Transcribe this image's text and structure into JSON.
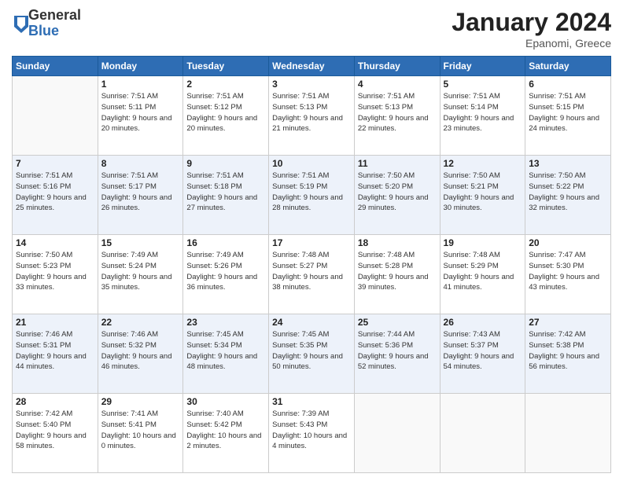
{
  "header": {
    "logo_general": "General",
    "logo_blue": "Blue",
    "title": "January 2024",
    "location": "Epanomi, Greece"
  },
  "weekdays": [
    "Sunday",
    "Monday",
    "Tuesday",
    "Wednesday",
    "Thursday",
    "Friday",
    "Saturday"
  ],
  "weeks": [
    [
      {
        "day": "",
        "sunrise": "",
        "sunset": "",
        "daylight": ""
      },
      {
        "day": "1",
        "sunrise": "Sunrise: 7:51 AM",
        "sunset": "Sunset: 5:11 PM",
        "daylight": "Daylight: 9 hours and 20 minutes."
      },
      {
        "day": "2",
        "sunrise": "Sunrise: 7:51 AM",
        "sunset": "Sunset: 5:12 PM",
        "daylight": "Daylight: 9 hours and 20 minutes."
      },
      {
        "day": "3",
        "sunrise": "Sunrise: 7:51 AM",
        "sunset": "Sunset: 5:13 PM",
        "daylight": "Daylight: 9 hours and 21 minutes."
      },
      {
        "day": "4",
        "sunrise": "Sunrise: 7:51 AM",
        "sunset": "Sunset: 5:13 PM",
        "daylight": "Daylight: 9 hours and 22 minutes."
      },
      {
        "day": "5",
        "sunrise": "Sunrise: 7:51 AM",
        "sunset": "Sunset: 5:14 PM",
        "daylight": "Daylight: 9 hours and 23 minutes."
      },
      {
        "day": "6",
        "sunrise": "Sunrise: 7:51 AM",
        "sunset": "Sunset: 5:15 PM",
        "daylight": "Daylight: 9 hours and 24 minutes."
      }
    ],
    [
      {
        "day": "7",
        "sunrise": "Sunrise: 7:51 AM",
        "sunset": "Sunset: 5:16 PM",
        "daylight": "Daylight: 9 hours and 25 minutes."
      },
      {
        "day": "8",
        "sunrise": "Sunrise: 7:51 AM",
        "sunset": "Sunset: 5:17 PM",
        "daylight": "Daylight: 9 hours and 26 minutes."
      },
      {
        "day": "9",
        "sunrise": "Sunrise: 7:51 AM",
        "sunset": "Sunset: 5:18 PM",
        "daylight": "Daylight: 9 hours and 27 minutes."
      },
      {
        "day": "10",
        "sunrise": "Sunrise: 7:51 AM",
        "sunset": "Sunset: 5:19 PM",
        "daylight": "Daylight: 9 hours and 28 minutes."
      },
      {
        "day": "11",
        "sunrise": "Sunrise: 7:50 AM",
        "sunset": "Sunset: 5:20 PM",
        "daylight": "Daylight: 9 hours and 29 minutes."
      },
      {
        "day": "12",
        "sunrise": "Sunrise: 7:50 AM",
        "sunset": "Sunset: 5:21 PM",
        "daylight": "Daylight: 9 hours and 30 minutes."
      },
      {
        "day": "13",
        "sunrise": "Sunrise: 7:50 AM",
        "sunset": "Sunset: 5:22 PM",
        "daylight": "Daylight: 9 hours and 32 minutes."
      }
    ],
    [
      {
        "day": "14",
        "sunrise": "Sunrise: 7:50 AM",
        "sunset": "Sunset: 5:23 PM",
        "daylight": "Daylight: 9 hours and 33 minutes."
      },
      {
        "day": "15",
        "sunrise": "Sunrise: 7:49 AM",
        "sunset": "Sunset: 5:24 PM",
        "daylight": "Daylight: 9 hours and 35 minutes."
      },
      {
        "day": "16",
        "sunrise": "Sunrise: 7:49 AM",
        "sunset": "Sunset: 5:26 PM",
        "daylight": "Daylight: 9 hours and 36 minutes."
      },
      {
        "day": "17",
        "sunrise": "Sunrise: 7:48 AM",
        "sunset": "Sunset: 5:27 PM",
        "daylight": "Daylight: 9 hours and 38 minutes."
      },
      {
        "day": "18",
        "sunrise": "Sunrise: 7:48 AM",
        "sunset": "Sunset: 5:28 PM",
        "daylight": "Daylight: 9 hours and 39 minutes."
      },
      {
        "day": "19",
        "sunrise": "Sunrise: 7:48 AM",
        "sunset": "Sunset: 5:29 PM",
        "daylight": "Daylight: 9 hours and 41 minutes."
      },
      {
        "day": "20",
        "sunrise": "Sunrise: 7:47 AM",
        "sunset": "Sunset: 5:30 PM",
        "daylight": "Daylight: 9 hours and 43 minutes."
      }
    ],
    [
      {
        "day": "21",
        "sunrise": "Sunrise: 7:46 AM",
        "sunset": "Sunset: 5:31 PM",
        "daylight": "Daylight: 9 hours and 44 minutes."
      },
      {
        "day": "22",
        "sunrise": "Sunrise: 7:46 AM",
        "sunset": "Sunset: 5:32 PM",
        "daylight": "Daylight: 9 hours and 46 minutes."
      },
      {
        "day": "23",
        "sunrise": "Sunrise: 7:45 AM",
        "sunset": "Sunset: 5:34 PM",
        "daylight": "Daylight: 9 hours and 48 minutes."
      },
      {
        "day": "24",
        "sunrise": "Sunrise: 7:45 AM",
        "sunset": "Sunset: 5:35 PM",
        "daylight": "Daylight: 9 hours and 50 minutes."
      },
      {
        "day": "25",
        "sunrise": "Sunrise: 7:44 AM",
        "sunset": "Sunset: 5:36 PM",
        "daylight": "Daylight: 9 hours and 52 minutes."
      },
      {
        "day": "26",
        "sunrise": "Sunrise: 7:43 AM",
        "sunset": "Sunset: 5:37 PM",
        "daylight": "Daylight: 9 hours and 54 minutes."
      },
      {
        "day": "27",
        "sunrise": "Sunrise: 7:42 AM",
        "sunset": "Sunset: 5:38 PM",
        "daylight": "Daylight: 9 hours and 56 minutes."
      }
    ],
    [
      {
        "day": "28",
        "sunrise": "Sunrise: 7:42 AM",
        "sunset": "Sunset: 5:40 PM",
        "daylight": "Daylight: 9 hours and 58 minutes."
      },
      {
        "day": "29",
        "sunrise": "Sunrise: 7:41 AM",
        "sunset": "Sunset: 5:41 PM",
        "daylight": "Daylight: 10 hours and 0 minutes."
      },
      {
        "day": "30",
        "sunrise": "Sunrise: 7:40 AM",
        "sunset": "Sunset: 5:42 PM",
        "daylight": "Daylight: 10 hours and 2 minutes."
      },
      {
        "day": "31",
        "sunrise": "Sunrise: 7:39 AM",
        "sunset": "Sunset: 5:43 PM",
        "daylight": "Daylight: 10 hours and 4 minutes."
      },
      {
        "day": "",
        "sunrise": "",
        "sunset": "",
        "daylight": ""
      },
      {
        "day": "",
        "sunrise": "",
        "sunset": "",
        "daylight": ""
      },
      {
        "day": "",
        "sunrise": "",
        "sunset": "",
        "daylight": ""
      }
    ]
  ]
}
